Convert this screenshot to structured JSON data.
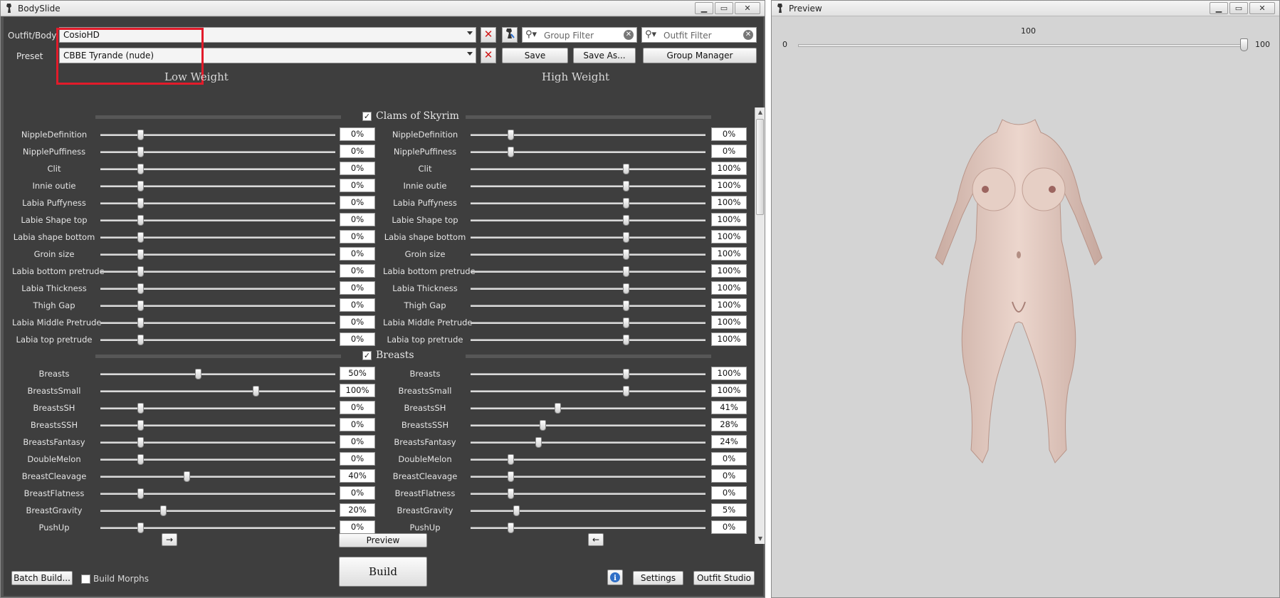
{
  "main_window": {
    "title": "BodySlide",
    "outfit_label": "Outfit/Body",
    "outfit_value": "CosioHD",
    "preset_label": "Preset",
    "preset_value": "CBBE Tyrande (nude)",
    "group_filter_placeholder": "Group Filter",
    "outfit_filter_placeholder": "Outfit Filter",
    "save_label": "Save",
    "save_as_label": "Save As...",
    "group_manager_label": "Group Manager",
    "low_weight_label": "Low Weight",
    "high_weight_label": "High Weight",
    "groups": [
      {
        "name": "Clams of Skyrim",
        "checked": true,
        "sliders": [
          {
            "name": "NippleDefinition",
            "low": "0%",
            "high": "0%"
          },
          {
            "name": "NipplePuffiness",
            "low": "0%",
            "high": "0%"
          },
          {
            "name": "Clit",
            "low": "0%",
            "high": "100%"
          },
          {
            "name": "Innie outie",
            "low": "0%",
            "high": "100%"
          },
          {
            "name": "Labia Puffyness",
            "low": "0%",
            "high": "100%"
          },
          {
            "name": "Labie Shape top",
            "low": "0%",
            "high": "100%"
          },
          {
            "name": "Labia shape bottom",
            "low": "0%",
            "high": "100%"
          },
          {
            "name": "Groin size",
            "low": "0%",
            "high": "100%"
          },
          {
            "name": "Labia bottom pretrude",
            "low": "0%",
            "high": "100%"
          },
          {
            "name": "Labia Thickness",
            "low": "0%",
            "high": "100%"
          },
          {
            "name": "Thigh Gap",
            "low": "0%",
            "high": "100%"
          },
          {
            "name": "Labia Middle Pretrude",
            "low": "0%",
            "high": "100%"
          },
          {
            "name": "Labia top pretrude",
            "low": "0%",
            "high": "100%"
          }
        ]
      },
      {
        "name": "Breasts",
        "checked": true,
        "sliders": [
          {
            "name": "Breasts",
            "low": "50%",
            "high": "100%"
          },
          {
            "name": "BreastsSmall",
            "low": "100%",
            "high": "100%"
          },
          {
            "name": "BreastsSH",
            "low": "0%",
            "high": "41%"
          },
          {
            "name": "BreastsSSH",
            "low": "0%",
            "high": "28%"
          },
          {
            "name": "BreastsFantasy",
            "low": "0%",
            "high": "24%"
          },
          {
            "name": "DoubleMelon",
            "low": "0%",
            "high": "0%"
          },
          {
            "name": "BreastCleavage",
            "low": "40%",
            "high": "0%"
          },
          {
            "name": "BreastFlatness",
            "low": "0%",
            "high": "0%"
          },
          {
            "name": "BreastGravity",
            "low": "20%",
            "high": "5%"
          },
          {
            "name": "PushUp",
            "low": "0%",
            "high": "0%"
          }
        ]
      }
    ],
    "copy_right_label": "→",
    "copy_left_label": "←",
    "preview_label": "Preview",
    "build_label": "Build",
    "batch_build_label": "Batch Build...",
    "build_morphs_label": "Build Morphs",
    "build_morphs_checked": false,
    "settings_label": "Settings",
    "outfit_studio_label": "Outfit Studio",
    "info_icon": "info-icon"
  },
  "preview_window": {
    "title": "Preview",
    "weight_min": "0",
    "weight_max": "100",
    "weight_value": "100"
  },
  "colors": {
    "panel_bg": "#3e3e3e",
    "highlight_box": "#e21b2a",
    "preview_bg": "#d4d4d4"
  }
}
